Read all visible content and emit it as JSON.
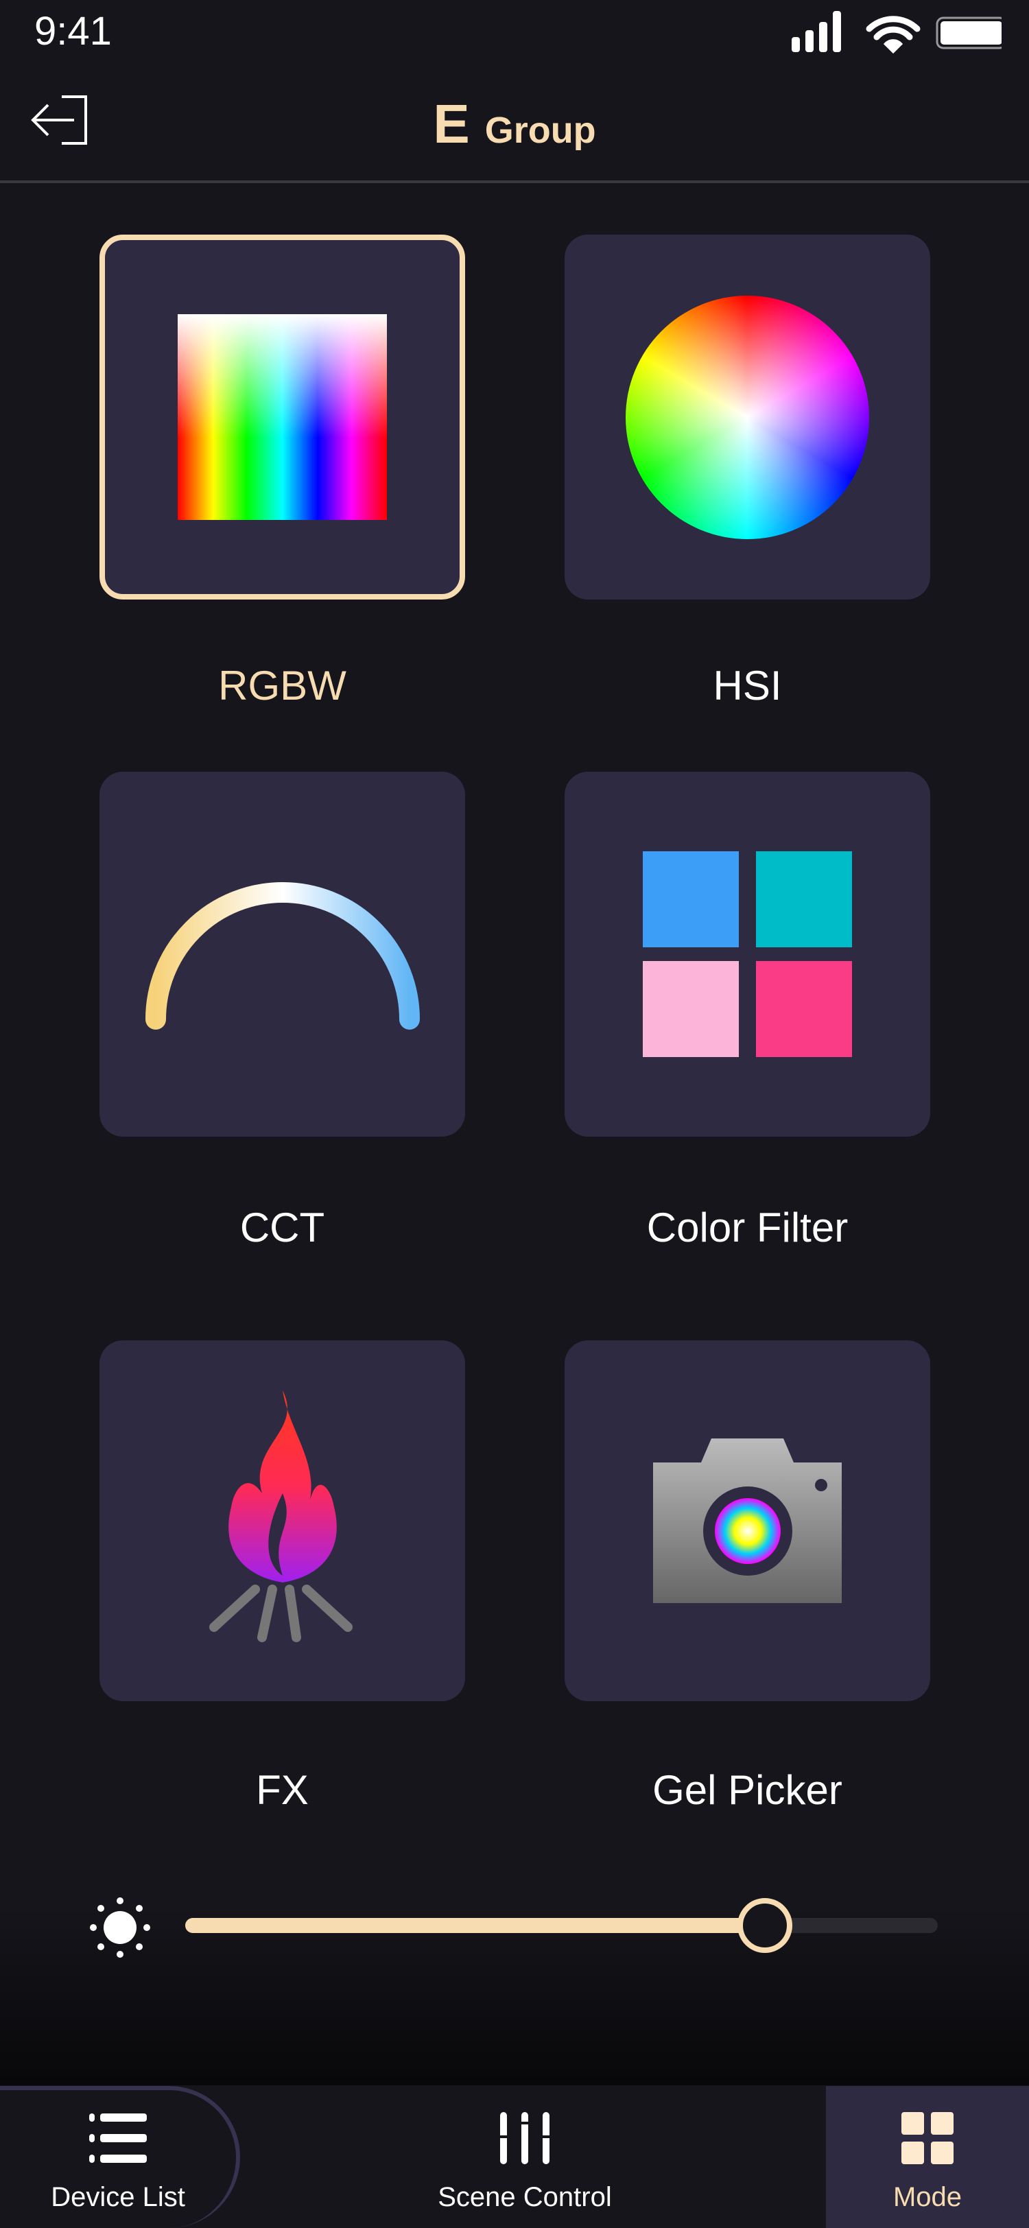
{
  "status_bar": {
    "time": "9:41"
  },
  "header": {
    "title_letter": "E",
    "title_text": "Group"
  },
  "modes": [
    {
      "label": "RGBW",
      "selected": true,
      "icon": "rgbw-gradient-icon"
    },
    {
      "label": "HSI",
      "selected": false,
      "icon": "color-wheel-icon"
    },
    {
      "label": "CCT",
      "selected": false,
      "icon": "cct-arc-icon"
    },
    {
      "label": "Color Filter",
      "selected": false,
      "icon": "color-filter-grid-icon"
    },
    {
      "label": "FX",
      "selected": false,
      "icon": "fire-icon"
    },
    {
      "label": "Gel Picker",
      "selected": false,
      "icon": "camera-icon"
    }
  ],
  "brightness": {
    "value_fraction": 0.77
  },
  "bottom_nav": [
    {
      "label": "Device List",
      "active": false
    },
    {
      "label": "Scene Control",
      "active": false
    },
    {
      "label": "Mode",
      "active": true
    }
  ],
  "colors": {
    "accent": "#f6dcb0",
    "tile": "#2d2a42",
    "background": "#16151b"
  }
}
